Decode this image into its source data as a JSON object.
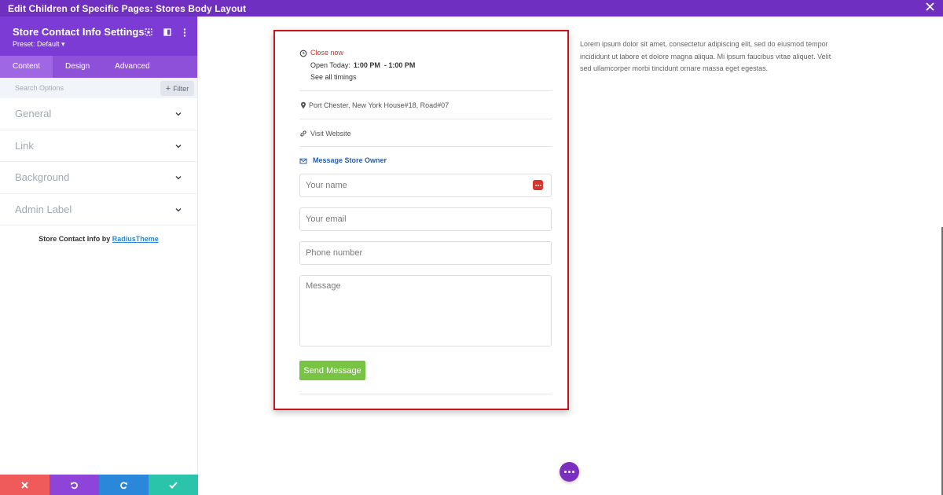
{
  "topbar": {
    "title": "Edit Children of Specific Pages: Stores Body Layout",
    "close_icon": "close-icon"
  },
  "sidebar": {
    "title": "Store Contact Info Settings",
    "preset": "Preset: Default ▾",
    "tabs": [
      {
        "label": "Content",
        "active": true
      },
      {
        "label": "Design",
        "active": false
      },
      {
        "label": "Advanced",
        "active": false
      }
    ],
    "search_placeholder": "Search Options",
    "filter_label": "Filter",
    "sections": [
      {
        "label": "General"
      },
      {
        "label": "Link"
      },
      {
        "label": "Background"
      },
      {
        "label": "Admin Label"
      }
    ],
    "credit_prefix": "Store Contact Info by ",
    "credit_link": "RadiusTheme"
  },
  "bottom_bar": {
    "buttons": [
      {
        "name": "discard-button",
        "icon": "x-icon",
        "color": "#ef5a5a"
      },
      {
        "name": "undo-button",
        "icon": "undo-icon",
        "color": "#8e44d8"
      },
      {
        "name": "redo-button",
        "icon": "redo-icon",
        "color": "#2b87da"
      },
      {
        "name": "save-button",
        "icon": "check-icon",
        "color": "#29c4a9"
      }
    ]
  },
  "store": {
    "status": "Close now",
    "open_today_label": "Open Today:",
    "open_today_hours": "1:00 PM  - 1:00 PM",
    "see_all": "See all timings",
    "address": "Port Chester, New York House#18, Road#07",
    "visit_website": "Visit Website",
    "message_owner": "Message Store Owner",
    "form": {
      "name_placeholder": "Your name",
      "email_placeholder": "Your email",
      "phone_placeholder": "Phone number",
      "message_placeholder": "Message",
      "send_label": "Send Message"
    }
  },
  "lorem": "Lorem ipsum dolor sit amet, consectetur adipiscing elit, sed do eiusmod tempor incididunt ut labore et dolore magna aliqua. Mi ipsum faucibus vitae aliquet. Velit sed ullamcorper morbi tincidunt ornare massa eget egestas.",
  "colors": {
    "accent": "#7d3bd6",
    "module_border": "#c8141b",
    "send_button": "#76c442",
    "status_closed": "#c0392b"
  }
}
